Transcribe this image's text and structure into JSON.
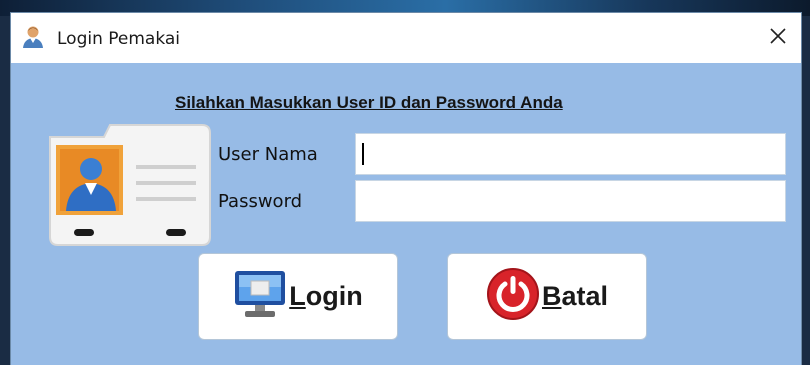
{
  "window": {
    "title": "Login Pemakai",
    "close_glyph": "✕"
  },
  "form": {
    "heading": "Silahkan Masukkan User ID dan Password Anda",
    "user_label": "User Nama",
    "user_value": "",
    "password_label": "Password",
    "password_value": ""
  },
  "buttons": {
    "login_mnemonic": "L",
    "login_rest": "ogin",
    "batal_mnemonic": "B",
    "batal_rest": "atal"
  },
  "icons": {
    "title": "user-login-icon",
    "card": "id-card-icon",
    "login": "monitor-icon",
    "batal": "power-icon"
  },
  "colors": {
    "dialog_bg": "#97bbe6",
    "titlebar_bg": "#ffffff",
    "power_red": "#d8232a"
  }
}
